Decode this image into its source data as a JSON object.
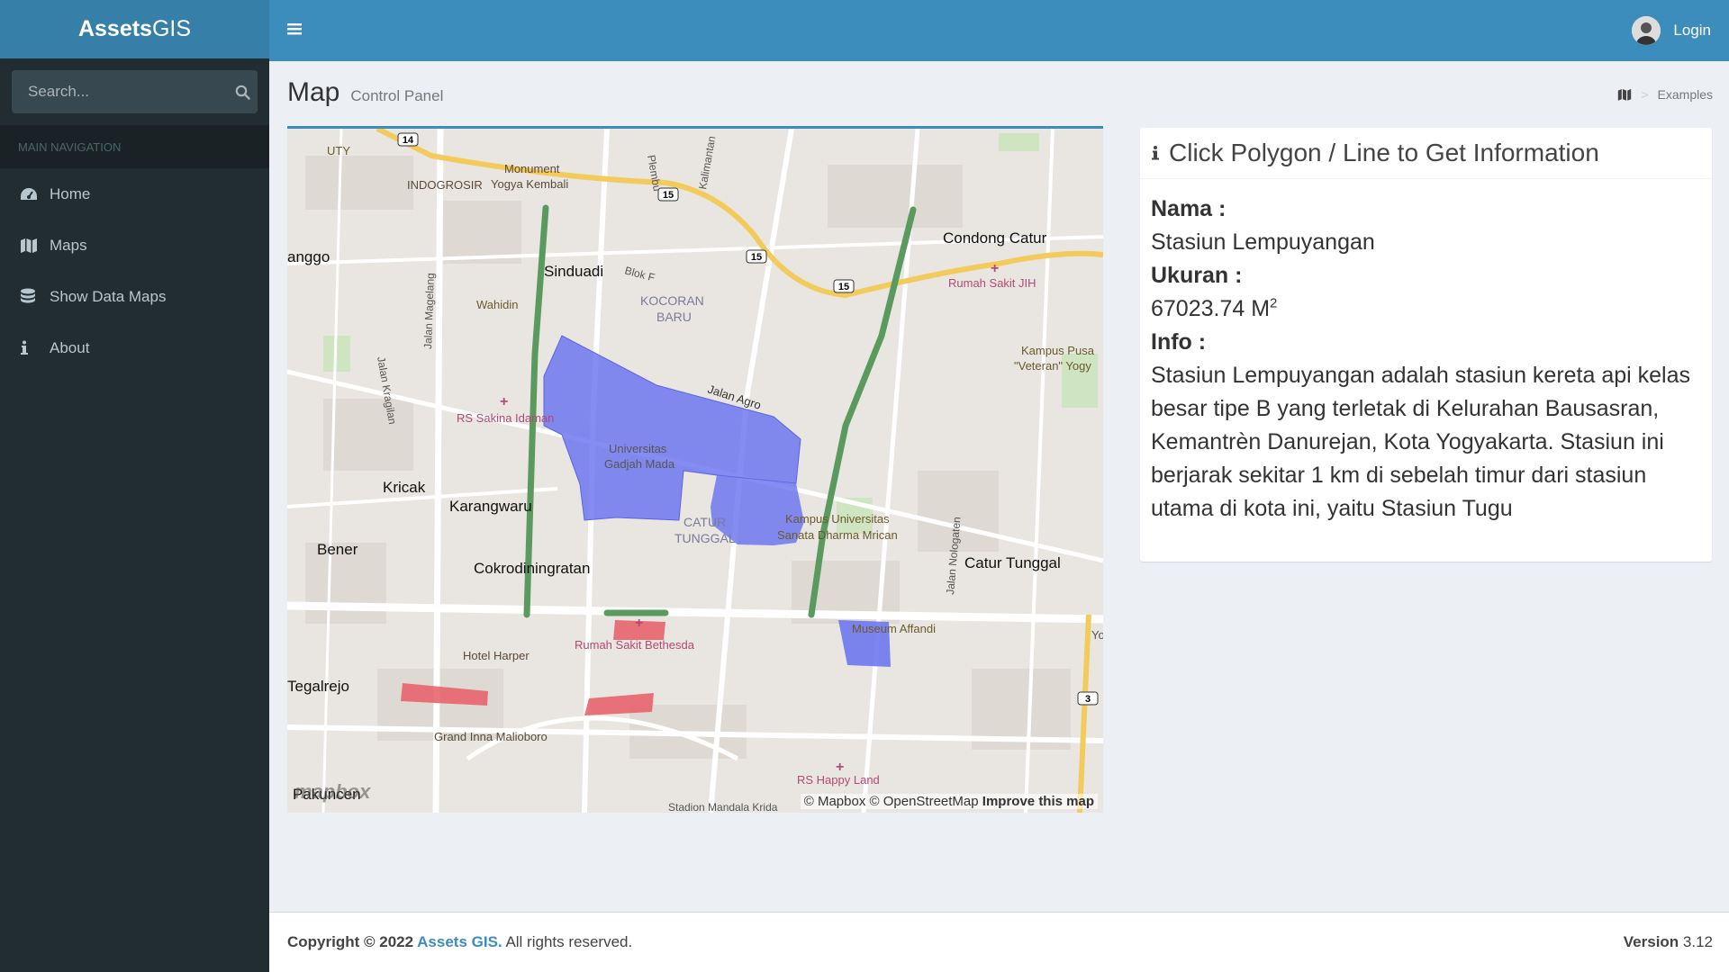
{
  "brand": {
    "bold": "Assets",
    "rest": "GIS"
  },
  "search": {
    "placeholder": "Search..."
  },
  "nav": {
    "header": "MAIN NAVIGATION",
    "items": [
      {
        "label": "Home",
        "icon": "dashboard-icon"
      },
      {
        "label": "Maps",
        "icon": "map-icon"
      },
      {
        "label": "Show Data Maps",
        "icon": "database-icon"
      },
      {
        "label": "About",
        "icon": "info-icon"
      }
    ]
  },
  "topbar": {
    "login_label": "Login"
  },
  "page": {
    "title": "Map",
    "subtitle": "Control Panel"
  },
  "breadcrumb": {
    "current": "Examples"
  },
  "map": {
    "labels": [
      "UTY",
      "Monument",
      "Yogya Kembali",
      "INDOGROSIR",
      "Plembu",
      "Kalimantan",
      "Condong Catur",
      "anggo",
      "Sinduadi",
      "Blok F",
      "KOCORAN",
      "BARU",
      "Rumah Sakit JIH",
      "Jalan Magelang",
      "Wahidin",
      "Kampus Pusa",
      "\"Veteran\" Yogy",
      "Jalan Kragilan",
      "RS Sakina Idaman",
      "Jalan Agro",
      "Universitas",
      "Gadjah Mada",
      "Kricak",
      "Karangwaru",
      "CATUR",
      "TUNGGAL",
      "Kampus Universitas",
      "Sanata Dharma Mrican",
      "Bener",
      "Cokrodiningratan",
      "Jalan Nologaten",
      "Catur Tunggal",
      "Museum Affandi",
      "Rumah Sakit Bethesda",
      "Hotel Harper",
      "Tegalrejo",
      "Grand Inna Malioboro",
      "RS Happy Land",
      "Pakuncen",
      "Stadion Mandala Krida",
      "Yo"
    ],
    "road_shields": [
      "14",
      "15",
      "15",
      "15",
      "3"
    ],
    "attribution": "© Mapbox © OpenStreetMap",
    "improve": "Improve this map",
    "logo": "mapbox"
  },
  "info": {
    "title": "Click Polygon / Line to Get Information",
    "nama_label": "Nama :",
    "nama": "Stasiun Lempuyangan",
    "ukuran_label": "Ukuran :",
    "ukuran": "67023.74 M",
    "ukuran_unit_sup": "2",
    "info_label": "Info :",
    "info_text": "Stasiun Lempuyangan adalah stasiun kereta api kelas besar tipe B yang terletak di Kelurahan Bausasran, Kemantrèn Danurejan, Kota Yogyakarta. Stasiun ini berjarak sekitar 1 km di sebelah timur dari stasiun utama di kota ini, yaitu Stasiun Tugu"
  },
  "footer": {
    "copyright": "Copyright © 2022 ",
    "brand_link": "Assets GIS.",
    "rights": " All rights reserved.",
    "version_label": "Version",
    "version": " 3.12"
  },
  "colors": {
    "sidebar": "#222d32",
    "header": "#3c8dbc",
    "logo_bg": "#367fa9",
    "polygon_blue": "#6670f0",
    "polygon_red": "#e8646e",
    "line_green": "#5a9a5e",
    "road_yellow": "#f2cb5c"
  }
}
